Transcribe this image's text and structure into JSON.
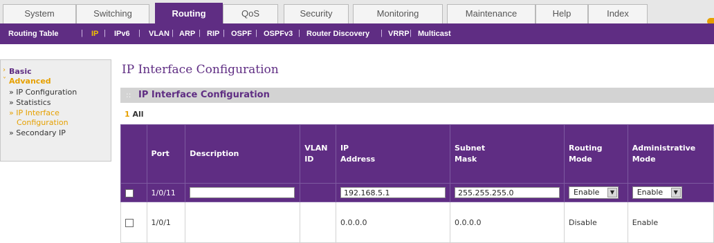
{
  "tabs": [
    {
      "label": "System",
      "active": false
    },
    {
      "label": "Switching",
      "active": false
    },
    {
      "label": "Routing",
      "active": true
    },
    {
      "label": "QoS",
      "active": false
    },
    {
      "label": "Security",
      "active": false
    },
    {
      "label": "Monitoring",
      "active": false
    },
    {
      "label": "Maintenance",
      "active": false
    },
    {
      "label": "Help",
      "active": false
    },
    {
      "label": "Index",
      "active": false
    }
  ],
  "subnav": [
    {
      "label": "Routing Table",
      "active": false
    },
    {
      "label": "IP",
      "active": true
    },
    {
      "label": "IPv6",
      "active": false
    },
    {
      "label": "VLAN",
      "active": false
    },
    {
      "label": "ARP",
      "active": false
    },
    {
      "label": "RIP",
      "active": false
    },
    {
      "label": "OSPF",
      "active": false
    },
    {
      "label": "OSPFv3",
      "active": false
    },
    {
      "label": "Router Discovery",
      "active": false
    },
    {
      "label": "VRRP",
      "active": false
    },
    {
      "label": "Multicast",
      "active": false
    }
  ],
  "sidebar": {
    "basic": "Basic",
    "advanced": "Advanced",
    "items": [
      {
        "label": "» IP Configuration"
      },
      {
        "label": "» Statistics"
      },
      {
        "label": "» IP Interface"
      },
      {
        "label": "Configuration"
      },
      {
        "label": "» Secondary IP"
      }
    ]
  },
  "page": {
    "title": "IP Interface Configuration",
    "section_title": "IP Interface Configuration",
    "section_dots": "::",
    "pager_number": "1",
    "pager_all": "All"
  },
  "table": {
    "headers": {
      "port": "Port",
      "description": "Description",
      "vlan_1": "VLAN",
      "vlan_2": "ID",
      "ip_1": "IP",
      "ip_2": "Address",
      "subnet_1": "Subnet",
      "subnet_2": "Mask",
      "routing_1": "Routing",
      "routing_2": "Mode",
      "admin_1": "Administrative",
      "admin_2": "Mode"
    },
    "edit_row": {
      "port": "1/0/11",
      "description": "",
      "vlan_id": "",
      "ip_address": "192.168.5.1",
      "subnet_mask": "255.255.255.0",
      "routing_mode": "Enable",
      "admin_mode": "Enable"
    },
    "rows": [
      {
        "port": "1/0/1",
        "description": "",
        "vlan_id": "",
        "ip_address": "0.0.0.0",
        "subnet_mask": "0.0.0.0",
        "routing_mode": "Disable",
        "admin_mode": "Enable"
      }
    ]
  },
  "colors": {
    "brand_purple": "#5f2d83",
    "accent_gold": "#e6a000"
  }
}
